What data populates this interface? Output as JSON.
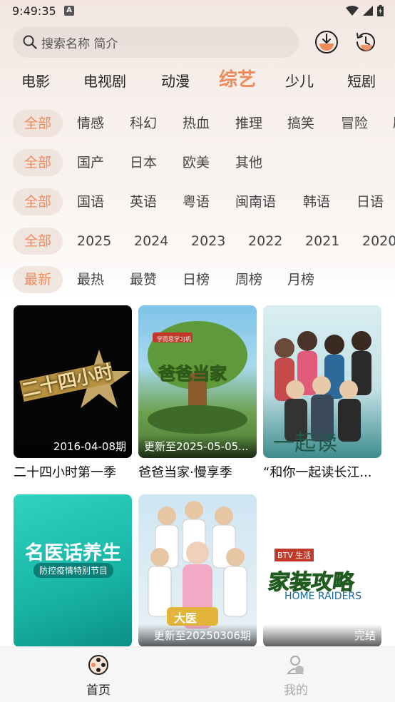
{
  "status": {
    "time": "9:49:35",
    "notif_letter": "A"
  },
  "search": {
    "placeholder": "搜索名称 简介"
  },
  "categories": [
    "电影",
    "电视剧",
    "动漫",
    "综艺",
    "少儿",
    "短剧"
  ],
  "active_category": "综艺",
  "filters": {
    "genre": [
      "全部",
      "情感",
      "科幻",
      "热血",
      "推理",
      "搞笑",
      "冒险",
      "剧"
    ],
    "region": [
      "全部",
      "国产",
      "日本",
      "欧美",
      "其他"
    ],
    "language": [
      "全部",
      "国语",
      "英语",
      "粤语",
      "闽南语",
      "韩语",
      "日语"
    ],
    "year": [
      "全部",
      "2025",
      "2024",
      "2023",
      "2022",
      "2021",
      "2020"
    ],
    "sort": [
      "最新",
      "最热",
      "最赞",
      "日榜",
      "周榜",
      "月榜"
    ]
  },
  "cards": [
    {
      "title": "二十四小时第一季",
      "badge": "2016-04-08期",
      "poster_text": "二十四小时"
    },
    {
      "title": "爸爸当家·慢享季",
      "badge": "更新至2025-05-05...",
      "poster_text": "爸爸当家",
      "poster_sub": "学而思学习机"
    },
    {
      "title": "“和你一起读长江...",
      "badge": "",
      "poster_text": "一起读"
    },
    {
      "title": "",
      "badge": "",
      "poster_text": "名医话养生",
      "poster_sub": "防控疫情特别节目"
    },
    {
      "title": "",
      "badge": "更新至20250306期",
      "poster_text": "大医"
    },
    {
      "title": "",
      "badge": "完结",
      "poster_text": "家装攻略",
      "poster_sub": "HOME RAIDERS",
      "poster_tag": "BTV 生活"
    }
  ],
  "bottom_nav": {
    "home": "首页",
    "mine": "我的"
  },
  "colors": {
    "accent": "#ef8b5b"
  }
}
